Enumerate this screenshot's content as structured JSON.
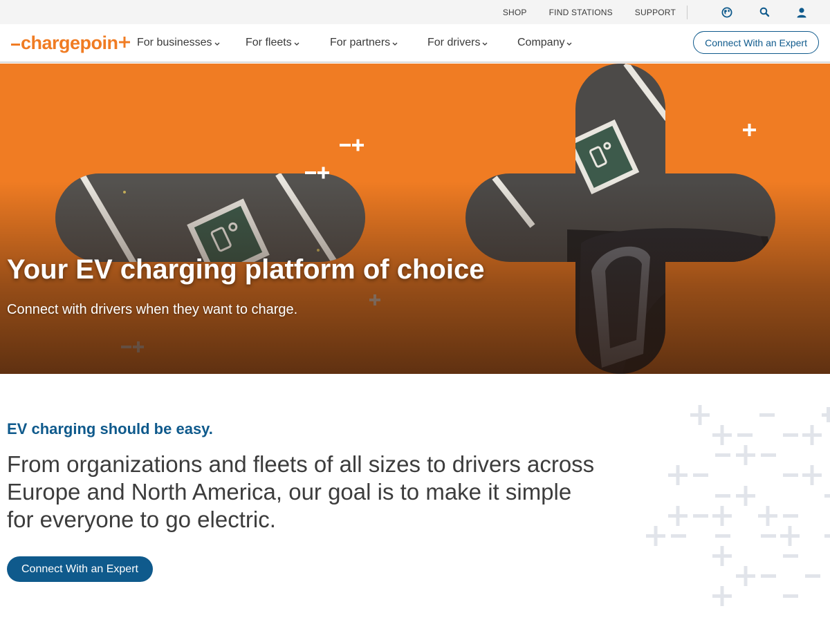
{
  "utility_bar": {
    "links": [
      "SHOP",
      "FIND STATIONS",
      "SUPPORT"
    ],
    "icons": [
      "globe-icon",
      "search-icon",
      "user-icon"
    ]
  },
  "brand": {
    "name": "chargepoint",
    "logo_text": "chargepoin",
    "accent": "#f07c23",
    "primary": "#0f5a8c"
  },
  "nav": {
    "items": [
      "For businesses",
      "For fleets",
      "For partners",
      "For drivers",
      "Company"
    ],
    "cta_label": "Connect With an Expert"
  },
  "hero": {
    "title": "Your EV charging platform of choice",
    "subtitle": "Connect with drivers when they want to charge."
  },
  "intro": {
    "eyebrow": "EV charging should be easy.",
    "body": "From organizations and fleets of all sizes to drivers across Europe and North America, our goal is to make it simple for everyone to go electric.",
    "cta_label": "Connect With an Expert"
  }
}
